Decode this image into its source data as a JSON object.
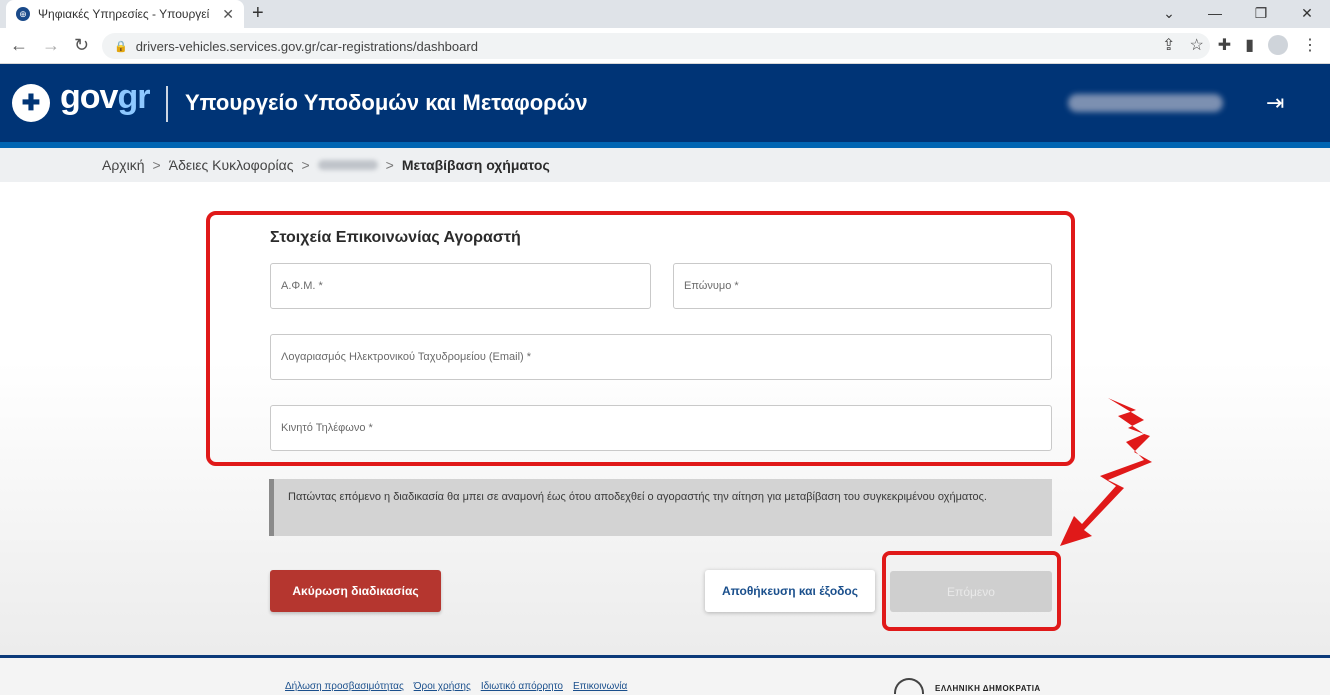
{
  "browser": {
    "tab_title": "Ψηφιακές Υπηρεσίες - Υπουργεί",
    "new_tab": "+",
    "url": "drivers-vehicles.services.gov.gr/car-registrations/dashboard"
  },
  "header": {
    "logo_gov": "gov",
    "logo_gr": "gr",
    "ministry": "Υπουργείο Υποδομών και Μεταφορών"
  },
  "breadcrumb": {
    "home": "Αρχική",
    "licenses": "Άδειες Κυκλοφορίας",
    "current": "Μεταβίβαση οχήματος",
    "separator": ">"
  },
  "form": {
    "section_title": "Στοιχεία Επικοινωνίας Αγοραστή",
    "afm_placeholder": "Α.Φ.Μ. *",
    "surname_placeholder": "Επώνυμο *",
    "email_placeholder": "Λογαριασμός Ηλεκτρονικού Ταχυδρομείου (Email) *",
    "phone_placeholder": "Κινητό Τηλέφωνο *",
    "info_text": "Πατώντας επόμενο η διαδικασία θα μπει σε αναμονή έως ότου αποδεχθεί ο αγοραστής την αίτηση για μεταβίβαση του συγκεκριμένου οχήματος."
  },
  "actions": {
    "cancel_label": "Ακύρωση διαδικασίας",
    "save_label": "Αποθήκευση και έξοδος",
    "next_label": "Επόμενο"
  },
  "footer": {
    "links": [
      "Δήλωση προσβασιμότητας",
      "Όροι χρήσης",
      "Ιδιωτικό απόρρητο",
      "Επικοινωνία"
    ],
    "republic": "ΕΛΛΗΝΙΚΗ ΔΗΜΟΚΡΑΤΙΑ"
  },
  "colors": {
    "header_bg": "#003476",
    "highlight": "#e01919",
    "cancel_bg": "#b5362f"
  }
}
